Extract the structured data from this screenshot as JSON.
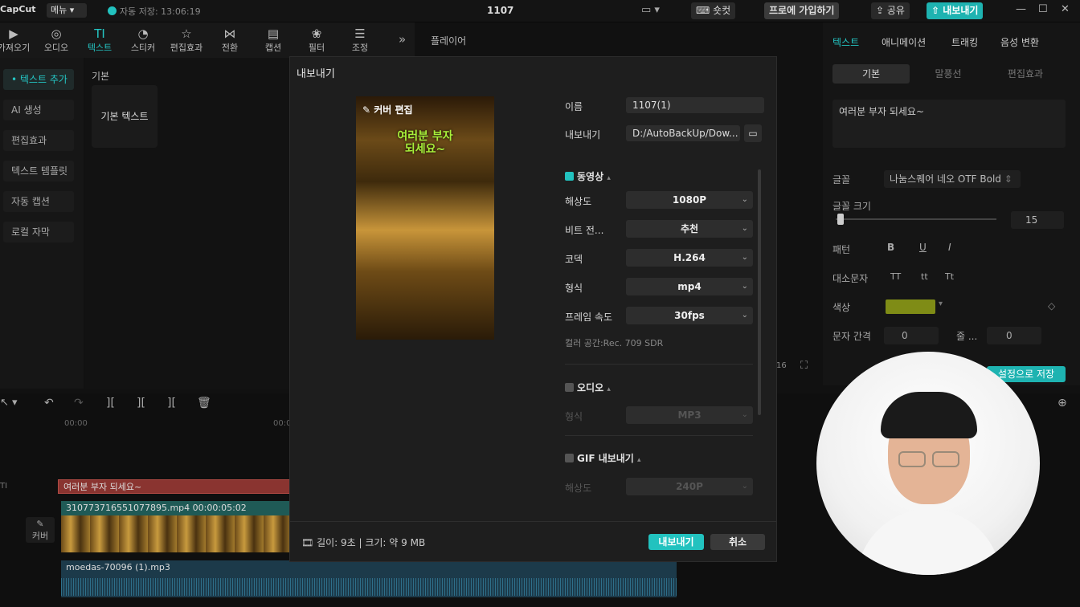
{
  "titlebar": {
    "logo": "CapCut",
    "menu": "메뉴",
    "autosave": "자동 저장: 13:06:19",
    "title": "1107",
    "shortcut": "숏컷",
    "pro": "프로에 가입하기",
    "share": "공유",
    "export": "내보내기"
  },
  "toolbar": {
    "items": [
      "가져오기",
      "오디오",
      "텍스트",
      "스티커",
      "편집효과",
      "전환",
      "캡션",
      "필터",
      "조정"
    ],
    "icons": [
      "▶",
      "◎",
      "TI",
      "◔",
      "☆",
      "⋈",
      "▤",
      "❀",
      "☰"
    ],
    "more": "»"
  },
  "left_panel": {
    "items": [
      "• 텍스트 추가",
      "AI 생성",
      "편집효과",
      "텍스트 템플릿",
      "자동 캡션",
      "로컬 자막"
    ]
  },
  "media_panel": {
    "section": "기본",
    "item": "기본 텍스트"
  },
  "player": {
    "title": "플레이어"
  },
  "props": {
    "tabs": [
      "텍스트",
      "애니메이션",
      "트래킹",
      "음성 변환"
    ],
    "subtabs": [
      "기본",
      "말풍선",
      "편집효과"
    ],
    "text_value": "여러분 부자 되세요~",
    "font_label": "글꼴",
    "font_value": "나눔스퀘어 네오 OTF Bold",
    "size_label": "글꼴 크기",
    "size_value": "15",
    "pattern_label": "패턴",
    "pattern_opts": [
      "B",
      "U",
      "I"
    ],
    "case_label": "대소문자",
    "case_opts": [
      "TT",
      "tt",
      "Tt"
    ],
    "color_label": "색상",
    "color_value": "#7f8c16",
    "spacing_label": "문자 간격",
    "spacing_value": "0",
    "line_label": "줄 ...",
    "line_value": "0",
    "save_default": "설정으로 저장"
  },
  "timeline": {
    "time": "00:00",
    "time2": "00:0",
    "text_track": "여러분 부자 되세요~",
    "video_track": "310773716551077895.mp4  00:00:05:02",
    "cover_label": "커버",
    "audio_track": "moedas-70096 (1).mp3"
  },
  "dialog": {
    "title": "내보내기",
    "cover_edit": "커버 편집",
    "cover_caption": "여러분 부자\n되세요~",
    "name_label": "이름",
    "name_value": "1107(1)",
    "export_label": "내보내기",
    "export_path": "D:/AutoBackUp/Dow...",
    "video_section": "동영상",
    "resolution_label": "해상도",
    "resolution_value": "1080P",
    "bitrate_label": "비트 전...",
    "bitrate_value": "추천",
    "codec_label": "코덱",
    "codec_value": "H.264",
    "format_label": "형식",
    "format_value": "mp4",
    "fps_label": "프레임 속도",
    "fps_value": "30fps",
    "colorspace": "컬러 공간:Rec. 709 SDR",
    "audio_section": "오디오",
    "audio_format_label": "형식",
    "audio_format_value": "MP3",
    "gif_section": "GIF 내보내기",
    "gif_res_label": "해상도",
    "gif_res_value": "240P",
    "footer_info": "길이: 9초 | 크기: 약 9 MB",
    "export_button": "내보내기",
    "cancel_button": "취소"
  }
}
